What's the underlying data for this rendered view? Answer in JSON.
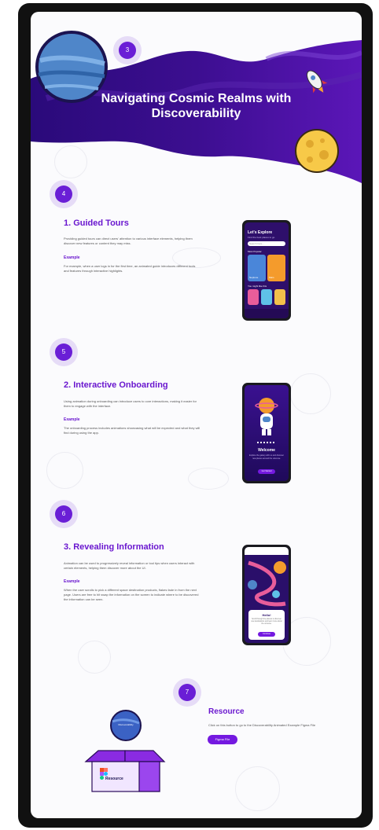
{
  "header": {
    "title_line1": "Navigating Cosmic Realms  with",
    "title_line2": "Discoverability",
    "step": "3"
  },
  "sections": [
    {
      "step": "4",
      "heading": "1. Guided Tours",
      "desc": "Providing guided tours can direct users' attention to various interface elements, helping them discover new features or content they may miss.",
      "example_label": "Example",
      "example": "For example, when a user logs in for the first time, an animated guide introduces different tools and features through interactive highlights."
    },
    {
      "step": "5",
      "heading": "2. Interactive Onboarding",
      "desc": "Using animation during onboarding can introduce users to core interactions, making it easier for them to engage with the interface.",
      "example_label": "Example",
      "example": "The onboarding process includes animations showcasing what will be expected and what they will find during using the app."
    },
    {
      "step": "6",
      "heading": "3. Revealing Information",
      "desc": "Animation can be used to progressively reveal information or tool tips when users interact with certain elements, helping them discover more about the UI.",
      "example_label": "Example",
      "example": "When the user scrolls to pick a different space destination products, flakes fade in from the next page. Users are free to hit swap the information on the screen to indicate where to be discovered the information can be seen."
    }
  ],
  "phone1": {
    "title": "Let's Explore",
    "subtitle": "Find the best places to go",
    "search": "Search here...",
    "section1": "Most Popular",
    "card1": "Neptune",
    "card2": "Mars",
    "section2": "You might like this"
  },
  "phone2": {
    "heading": "Welcome",
    "body": "Explore the galaxy with us and discover new places around the universe.",
    "button": "Get Started"
  },
  "phone3": {
    "heading": "Hello!",
    "body": "Scroll through the planets to discover new destinations and learn more about the universe.",
    "button": "Continue"
  },
  "resource": {
    "step": "7",
    "heading": "Resource",
    "desc": "Click on this button to go to the Discoverability Animated Example Figma File",
    "button": "Figma File",
    "box_label": "Resource",
    "sphere_label": "Discoverability"
  },
  "colors": {
    "primary": "#6a17cf",
    "header": "#3a0d8c",
    "badge_bg": "#e6dcf7"
  }
}
